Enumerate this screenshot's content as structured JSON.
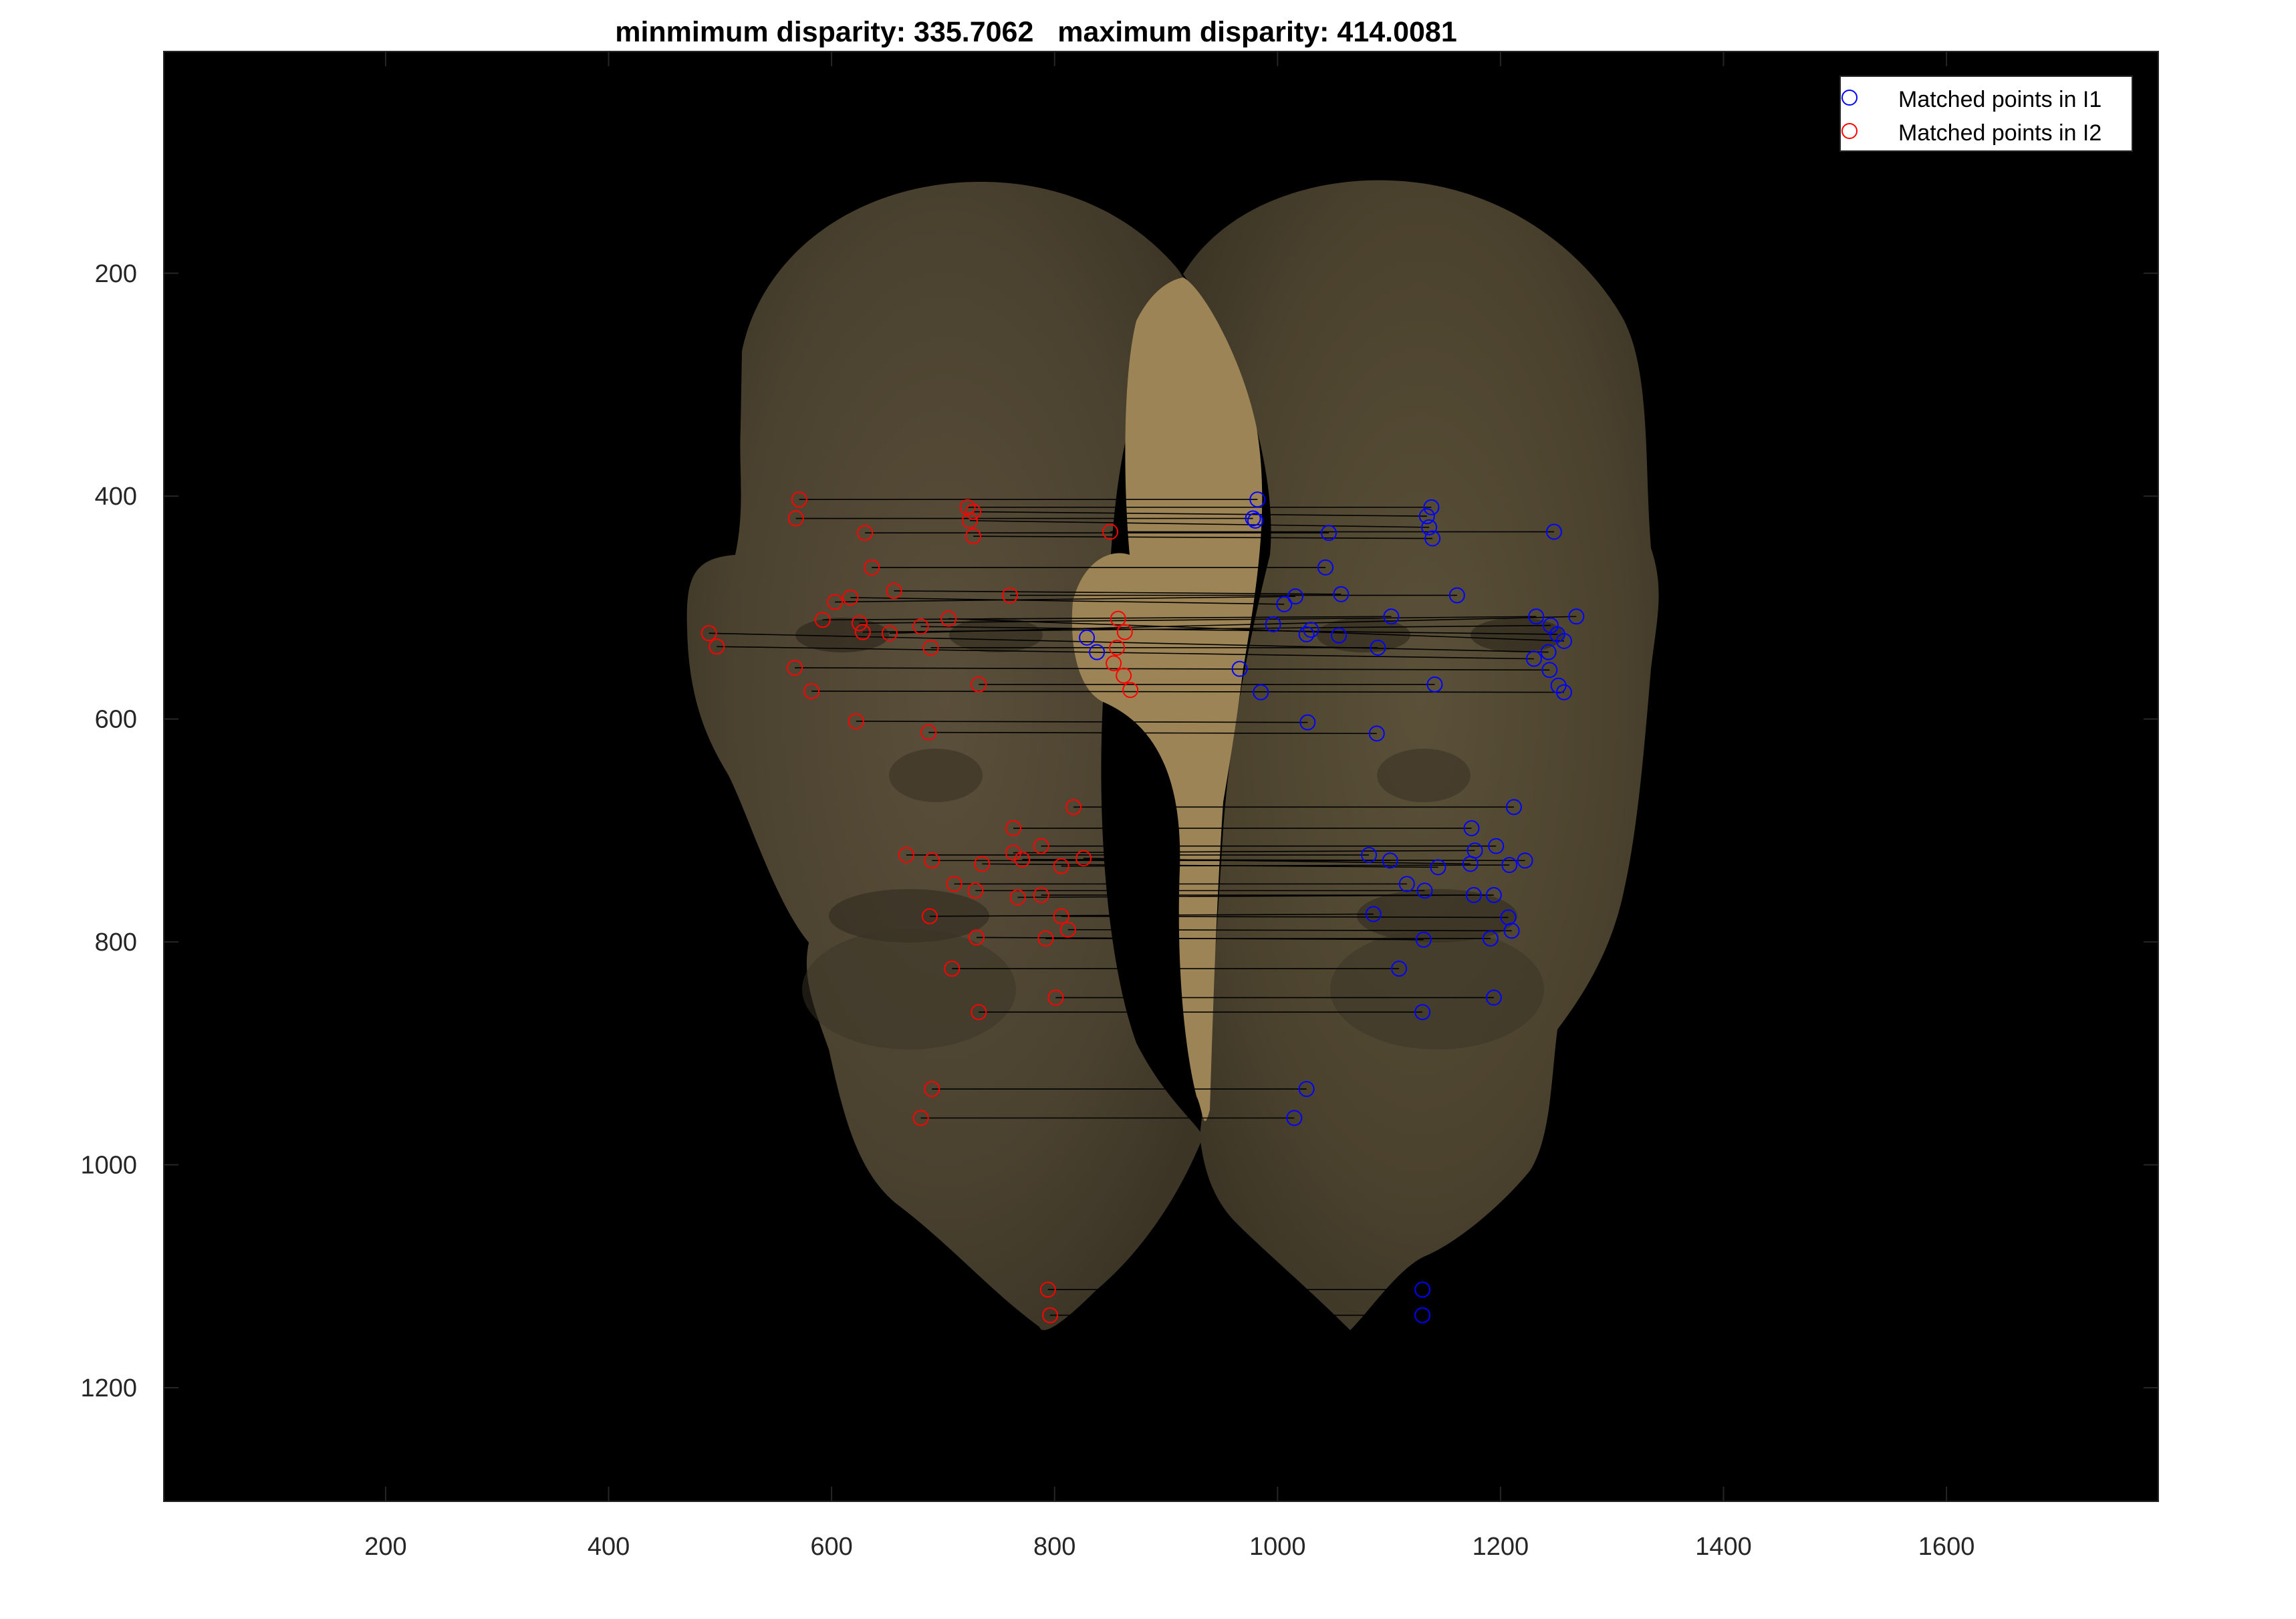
{
  "chart_data": {
    "type": "scatter",
    "title": "minmimum disparity: 335.7062   maximum disparity: 414.0081",
    "xlabel": "",
    "ylabel": "",
    "xlim": [
      1,
      1790
    ],
    "ylim": [
      1,
      1302
    ],
    "y_axis_direction": "reversed",
    "grid": false,
    "legend_position": "top-right",
    "x_ticks": [
      200,
      400,
      600,
      800,
      1000,
      1200,
      1400,
      1600
    ],
    "y_ticks": [
      200,
      400,
      600,
      800,
      1000,
      1200
    ],
    "x_tick_labels": [
      "200",
      "400",
      "600",
      "800",
      "1000",
      "1200",
      "1400",
      "1600"
    ],
    "y_tick_labels": [
      "200",
      "400",
      "600",
      "800",
      "1000",
      "1200"
    ],
    "background_image": "anaglyph-style overlay of two matched face images (left face and right face) on black",
    "series": [
      {
        "name": "Matched points in I1",
        "color": "#0000ff",
        "marker": "circle",
        "points": [
          [
            982,
            403
          ],
          [
            978,
            420
          ],
          [
            980,
            422
          ],
          [
            1138,
            410
          ],
          [
            1134,
            418
          ],
          [
            1136,
            428
          ],
          [
            1139,
            438
          ],
          [
            1046,
            433
          ],
          [
            1248,
            432
          ],
          [
            1043,
            464
          ],
          [
            1057,
            488
          ],
          [
            1016,
            490
          ],
          [
            1006,
            497
          ],
          [
            1161,
            489
          ],
          [
            1102,
            508
          ],
          [
            996,
            515
          ],
          [
            1030,
            520
          ],
          [
            1026,
            524
          ],
          [
            1055,
            525
          ],
          [
            1090,
            536
          ],
          [
            1232,
            508
          ],
          [
            1245,
            516
          ],
          [
            1268,
            508
          ],
          [
            1251,
            524
          ],
          [
            1243,
            540
          ],
          [
            1230,
            546
          ],
          [
            1244,
            556
          ],
          [
            1257,
            530
          ],
          [
            1252,
            570
          ],
          [
            1257,
            576
          ],
          [
            966,
            555
          ],
          [
            985,
            576
          ],
          [
            1141,
            569
          ],
          [
            1027,
            603
          ],
          [
            1089,
            613
          ],
          [
            829,
            527
          ],
          [
            838,
            540
          ],
          [
            1212,
            679
          ],
          [
            1174,
            698
          ],
          [
            1196,
            714
          ],
          [
            1177,
            718
          ],
          [
            1082,
            722
          ],
          [
            1101,
            727
          ],
          [
            1222,
            727
          ],
          [
            1144,
            733
          ],
          [
            1208,
            731
          ],
          [
            1173,
            730
          ],
          [
            1116,
            748
          ],
          [
            1132,
            754
          ],
          [
            1176,
            758
          ],
          [
            1194,
            758
          ],
          [
            1086,
            775
          ],
          [
            1207,
            778
          ],
          [
            1210,
            790
          ],
          [
            1131,
            798
          ],
          [
            1191,
            797
          ],
          [
            1109,
            824
          ],
          [
            1194,
            850
          ],
          [
            1130,
            863
          ],
          [
            1026,
            932
          ],
          [
            1015,
            958
          ],
          [
            1130,
            1112
          ],
          [
            1130,
            1135
          ]
        ]
      },
      {
        "name": "Matched points in I2",
        "color": "#ff0000",
        "marker": "circle",
        "points": [
          [
            571,
            403
          ],
          [
            568,
            420
          ],
          [
            722,
            410
          ],
          [
            727,
            414
          ],
          [
            724,
            422
          ],
          [
            727,
            436
          ],
          [
            630,
            433
          ],
          [
            850,
            432
          ],
          [
            636,
            464
          ],
          [
            656,
            485
          ],
          [
            603,
            495
          ],
          [
            617,
            491
          ],
          [
            760,
            489
          ],
          [
            592,
            511
          ],
          [
            625,
            514
          ],
          [
            628,
            522
          ],
          [
            652,
            523
          ],
          [
            680,
            517
          ],
          [
            705,
            510
          ],
          [
            689,
            536
          ],
          [
            490,
            523
          ],
          [
            497,
            535
          ],
          [
            567,
            554
          ],
          [
            582,
            575
          ],
          [
            732,
            569
          ],
          [
            622,
            602
          ],
          [
            687,
            612
          ],
          [
            857,
            510
          ],
          [
            863,
            522
          ],
          [
            856,
            536
          ],
          [
            853,
            550
          ],
          [
            862,
            561
          ],
          [
            868,
            574
          ],
          [
            817,
            679
          ],
          [
            763,
            698
          ],
          [
            788,
            714
          ],
          [
            763,
            720
          ],
          [
            667,
            722
          ],
          [
            690,
            727
          ],
          [
            771,
            726
          ],
          [
            735,
            730
          ],
          [
            806,
            732
          ],
          [
            826,
            725
          ],
          [
            710,
            748
          ],
          [
            729,
            754
          ],
          [
            767,
            760
          ],
          [
            788,
            758
          ],
          [
            688,
            777
          ],
          [
            806,
            777
          ],
          [
            812,
            789
          ],
          [
            730,
            796
          ],
          [
            792,
            797
          ],
          [
            708,
            824
          ],
          [
            801,
            850
          ],
          [
            732,
            863
          ],
          [
            690,
            932
          ],
          [
            680,
            958
          ],
          [
            794,
            1112
          ],
          [
            796,
            1135
          ]
        ]
      }
    ],
    "match_lines": [
      [
        [
          571,
          403
        ],
        [
          982,
          403
        ]
      ],
      [
        [
          568,
          420
        ],
        [
          978,
          420
        ]
      ],
      [
        [
          722,
          410
        ],
        [
          1138,
          410
        ]
      ],
      [
        [
          727,
          414
        ],
        [
          1134,
          418
        ]
      ],
      [
        [
          724,
          422
        ],
        [
          1136,
          428
        ]
      ],
      [
        [
          727,
          436
        ],
        [
          1139,
          438
        ]
      ],
      [
        [
          630,
          433
        ],
        [
          1046,
          433
        ]
      ],
      [
        [
          850,
          432
        ],
        [
          1248,
          432
        ]
      ],
      [
        [
          636,
          464
        ],
        [
          1043,
          464
        ]
      ],
      [
        [
          656,
          485
        ],
        [
          1057,
          488
        ]
      ],
      [
        [
          603,
          495
        ],
        [
          1016,
          490
        ]
      ],
      [
        [
          617,
          491
        ],
        [
          1006,
          497
        ]
      ],
      [
        [
          760,
          489
        ],
        [
          1161,
          489
        ]
      ],
      [
        [
          592,
          511
        ],
        [
          1102,
          508
        ]
      ],
      [
        [
          625,
          514
        ],
        [
          1232,
          508
        ]
      ],
      [
        [
          628,
          522
        ],
        [
          1245,
          516
        ]
      ],
      [
        [
          652,
          523
        ],
        [
          1268,
          508
        ]
      ],
      [
        [
          680,
          517
        ],
        [
          1251,
          524
        ]
      ],
      [
        [
          705,
          510
        ],
        [
          1257,
          530
        ]
      ],
      [
        [
          689,
          536
        ],
        [
          1090,
          536
        ]
      ],
      [
        [
          490,
          523
        ],
        [
          1243,
          540
        ]
      ],
      [
        [
          497,
          535
        ],
        [
          1230,
          546
        ]
      ],
      [
        [
          567,
          554
        ],
        [
          1244,
          556
        ]
      ],
      [
        [
          582,
          575
        ],
        [
          1257,
          576
        ]
      ],
      [
        [
          732,
          569
        ],
        [
          1141,
          569
        ]
      ],
      [
        [
          622,
          602
        ],
        [
          1027,
          603
        ]
      ],
      [
        [
          687,
          612
        ],
        [
          1089,
          613
        ]
      ],
      [
        [
          817,
          679
        ],
        [
          1212,
          679
        ]
      ],
      [
        [
          763,
          698
        ],
        [
          1174,
          698
        ]
      ],
      [
        [
          788,
          714
        ],
        [
          1196,
          714
        ]
      ],
      [
        [
          763,
          720
        ],
        [
          1177,
          718
        ]
      ],
      [
        [
          667,
          722
        ],
        [
          1082,
          722
        ]
      ],
      [
        [
          690,
          727
        ],
        [
          1101,
          727
        ]
      ],
      [
        [
          771,
          726
        ],
        [
          1222,
          727
        ]
      ],
      [
        [
          735,
          730
        ],
        [
          1144,
          733
        ]
      ],
      [
        [
          806,
          732
        ],
        [
          1208,
          731
        ]
      ],
      [
        [
          826,
          725
        ],
        [
          1173,
          730
        ]
      ],
      [
        [
          710,
          748
        ],
        [
          1116,
          748
        ]
      ],
      [
        [
          729,
          754
        ],
        [
          1132,
          754
        ]
      ],
      [
        [
          767,
          760
        ],
        [
          1176,
          758
        ]
      ],
      [
        [
          788,
          758
        ],
        [
          1194,
          758
        ]
      ],
      [
        [
          688,
          777
        ],
        [
          1086,
          775
        ]
      ],
      [
        [
          806,
          777
        ],
        [
          1207,
          778
        ]
      ],
      [
        [
          812,
          789
        ],
        [
          1210,
          790
        ]
      ],
      [
        [
          730,
          796
        ],
        [
          1131,
          798
        ]
      ],
      [
        [
          792,
          797
        ],
        [
          1191,
          797
        ]
      ],
      [
        [
          708,
          824
        ],
        [
          1109,
          824
        ]
      ],
      [
        [
          801,
          850
        ],
        [
          1194,
          850
        ]
      ],
      [
        [
          732,
          863
        ],
        [
          1130,
          863
        ]
      ],
      [
        [
          690,
          932
        ],
        [
          1026,
          932
        ]
      ],
      [
        [
          680,
          958
        ],
        [
          1015,
          958
        ]
      ],
      [
        [
          794,
          1112
        ],
        [
          1130,
          1112
        ]
      ],
      [
        [
          796,
          1135
        ],
        [
          1130,
          1135
        ]
      ]
    ]
  }
}
